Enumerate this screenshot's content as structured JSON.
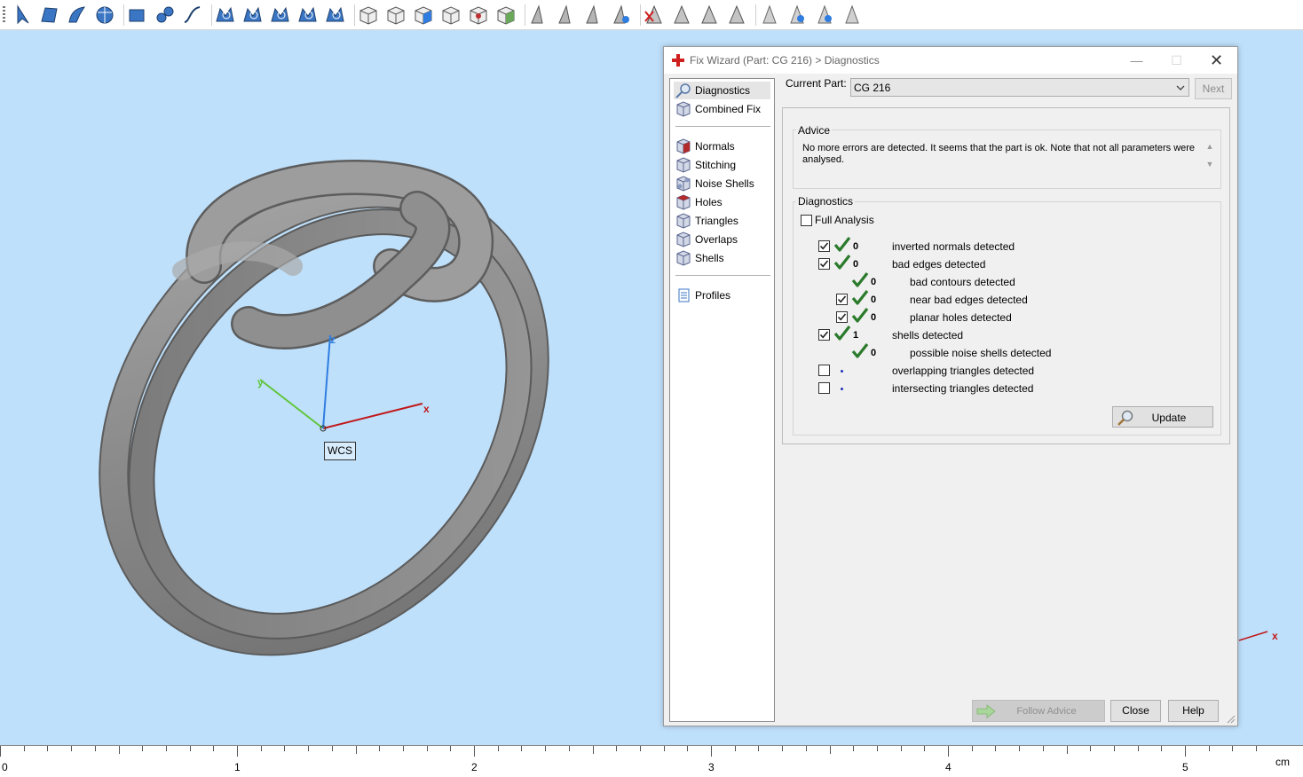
{
  "toolbar": {
    "icons": [
      "select-triangle-icon",
      "select-surface-icon",
      "select-shell-icon",
      "select-part-icon",
      "mark-plane-icon",
      "mark-shell-icon",
      "mark-curve-icon",
      "select-region-icon",
      "select-cluster-icon",
      "select-connected-icon",
      "select-all-icon",
      "invert-selection-icon",
      "view-front-icon",
      "view-top-icon",
      "view-perspective-icon",
      "view-wireframe-icon",
      "view-shaded-icon",
      "view-texture-icon",
      "cut-icon",
      "extrude-icon",
      "offset-icon",
      "hollow-icon",
      "delete-marked-icon",
      "remove-triangles-icon",
      "reduce-icon",
      "smooth-icon",
      "measure-icon",
      "section-icon",
      "color-icon",
      "label-icon"
    ]
  },
  "viewport": {
    "wcs_label": "WCS",
    "axis_x": "x",
    "axis_y": "y",
    "axis_z": "z",
    "corner_axis": "x",
    "colors": {
      "background": "#bfe0fb",
      "model": "#8c8c8c",
      "x_axis": "#c01818",
      "y_axis": "#5fc63a",
      "z_axis": "#2f7de0"
    }
  },
  "ruler": {
    "labels": [
      "0",
      "1",
      "2",
      "3",
      "4",
      "5"
    ],
    "unit": "cm"
  },
  "dialog": {
    "title": "Fix Wizard (Part: CG 216) > Diagnostics",
    "window_controls": {
      "minimize": "—",
      "maximize": "☐",
      "close": "✕"
    },
    "sidebar": {
      "group1": [
        {
          "label": "Diagnostics",
          "icon": "magnifier-icon",
          "active": true
        },
        {
          "label": "Combined Fix",
          "icon": "cube-icon"
        }
      ],
      "group2": [
        {
          "label": "Normals",
          "icon": "normals-cube-icon"
        },
        {
          "label": "Stitching",
          "icon": "stitching-cube-icon"
        },
        {
          "label": "Noise Shells",
          "icon": "noise-shells-icon"
        },
        {
          "label": "Holes",
          "icon": "holes-cube-icon"
        },
        {
          "label": "Triangles",
          "icon": "triangles-cube-icon"
        },
        {
          "label": "Overlaps",
          "icon": "overlaps-cube-icon"
        },
        {
          "label": "Shells",
          "icon": "shells-cube-icon"
        }
      ],
      "group3": [
        {
          "label": "Profiles",
          "icon": "document-icon"
        }
      ]
    },
    "current_part_label": "Current Part:",
    "current_part_value": "CG 216",
    "next_label": "Next",
    "advice_title": "Advice",
    "advice_text": "No more errors are detected. It seems that the part is ok. Note that not all parameters were analysed.",
    "diagnostics_title": "Diagnostics",
    "full_analysis_label": "Full Analysis",
    "full_analysis_checked": false,
    "rows": [
      {
        "checkbox": true,
        "status": "check",
        "count": "0",
        "label": "inverted normals detected"
      },
      {
        "checkbox": true,
        "status": "check",
        "count": "0",
        "label": "bad edges detected"
      },
      {
        "checkbox": null,
        "status": "check",
        "count": "0",
        "label": "bad contours detected"
      },
      {
        "checkbox": true,
        "status": "check",
        "count": "0",
        "label": "near bad edges detected"
      },
      {
        "checkbox": true,
        "status": "check",
        "count": "0",
        "label": "planar holes detected"
      },
      {
        "checkbox": true,
        "status": "check",
        "count": "1",
        "label": "shells detected"
      },
      {
        "checkbox": null,
        "status": "check",
        "count": "0",
        "label": "possible noise shells detected"
      },
      {
        "checkbox": false,
        "status": "dot",
        "count": "",
        "label": "overlapping triangles detected"
      },
      {
        "checkbox": false,
        "status": "dot",
        "count": "",
        "label": "intersecting triangles detected"
      }
    ],
    "update_label": "Update",
    "follow_advice_label": "Follow Advice",
    "close_label": "Close",
    "help_label": "Help"
  }
}
